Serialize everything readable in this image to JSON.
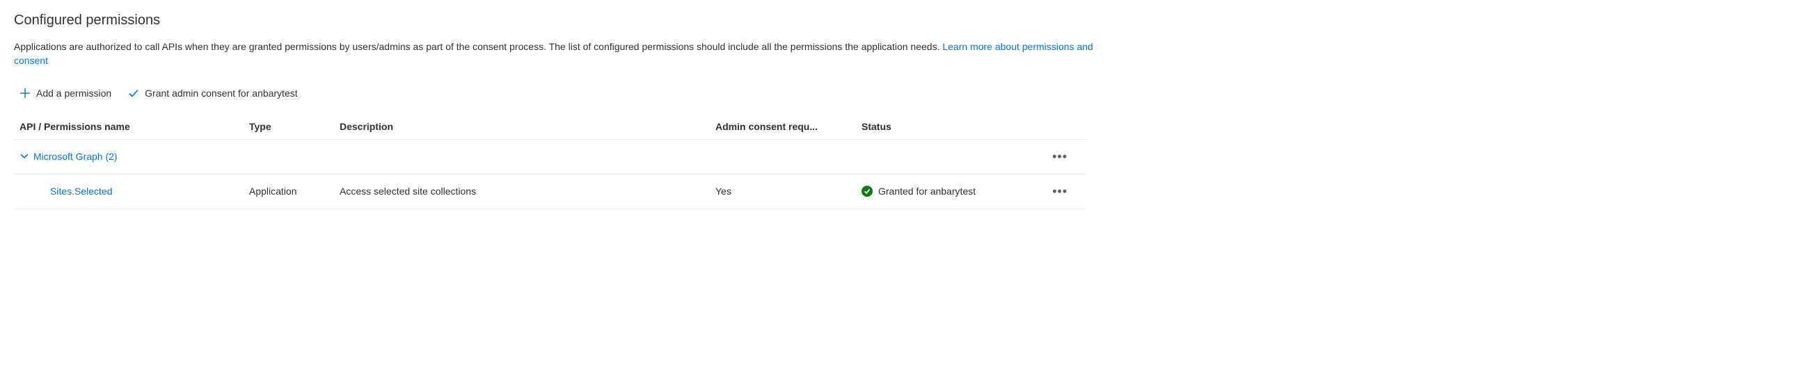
{
  "title": "Configured permissions",
  "description_part1": "Applications are authorized to call APIs when they are granted permissions by users/admins as part of the consent process. The list of configured permissions should include all the permissions the application needs. ",
  "learn_more_label": "Learn more about permissions and consent",
  "toolbar": {
    "add_permission_label": "Add a permission",
    "grant_consent_label": "Grant admin consent for anbarytest"
  },
  "columns": {
    "api_name": "API / Permissions name",
    "type": "Type",
    "description": "Description",
    "admin_consent": "Admin consent requ...",
    "status": "Status"
  },
  "group": {
    "label": "Microsoft Graph (2)"
  },
  "rows": [
    {
      "name": "Sites.Selected",
      "type": "Application",
      "description": "Access selected site collections",
      "admin_consent": "Yes",
      "status": "Granted for anbarytest"
    }
  ],
  "more_glyph": "•••"
}
